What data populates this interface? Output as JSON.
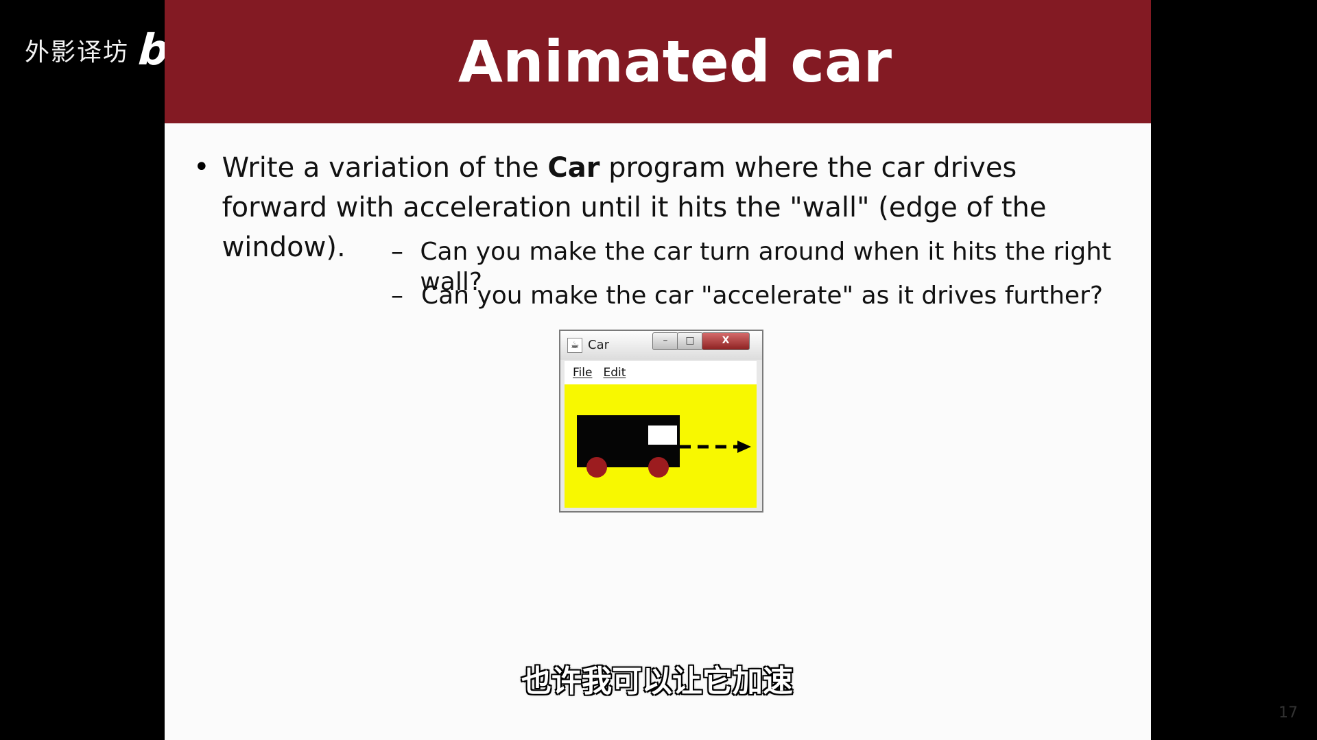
{
  "watermark": {
    "cn": "外影译坊",
    "logo": "bilibili"
  },
  "slide": {
    "title": "Animated car",
    "bullet": {
      "pre": "Write a variation of the ",
      "bold": "Car",
      "post": " program where the car drives forward with acceleration until it hits the \"wall\" (edge of the window)."
    },
    "sub_bullets": [
      "Can you make the car turn around when it hits the right wall?",
      "Can you make the car \"accelerate\" as it drives further?"
    ],
    "page_number": "17"
  },
  "window": {
    "title": "Car",
    "menu": [
      "File",
      "Edit"
    ],
    "buttons": {
      "min": "–",
      "max": "□",
      "close": "X"
    },
    "canvas_color": "#f8f800",
    "car_color": "#050505",
    "wheel_color": "#9c1c1f"
  },
  "subtitle": "也许我可以让它加速",
  "colors": {
    "title_bar": "#831a23",
    "background": "#000000",
    "slide_bg": "#fbfbfb"
  }
}
